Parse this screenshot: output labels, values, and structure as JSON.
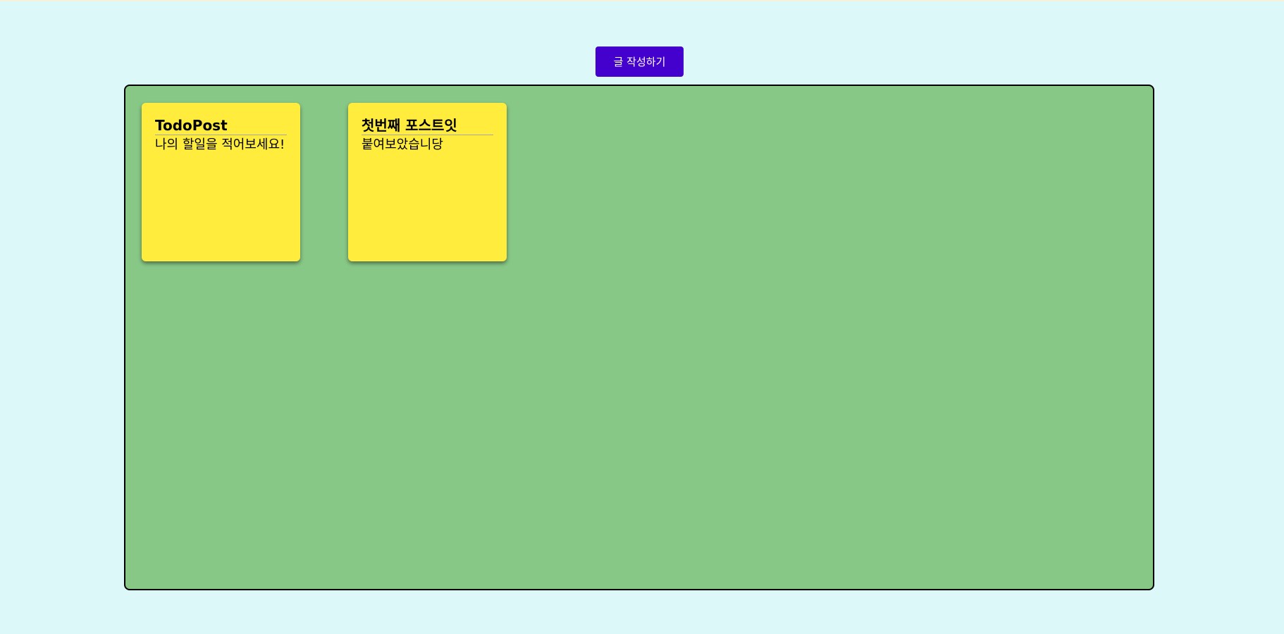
{
  "toolbar": {
    "write_label": "글 작성하기"
  },
  "board": {
    "notes": [
      {
        "title": "TodoPost",
        "body": "나의 할일을 적어보세요!"
      },
      {
        "title": "첫번째 포스트잇",
        "body": "붙여보았습니당"
      }
    ]
  },
  "colors": {
    "page_background": "#dcf8f8",
    "board_background": "#88c886",
    "note_background": "#ffec3d",
    "button_background": "#4400cc",
    "button_text": "#ffffff"
  }
}
